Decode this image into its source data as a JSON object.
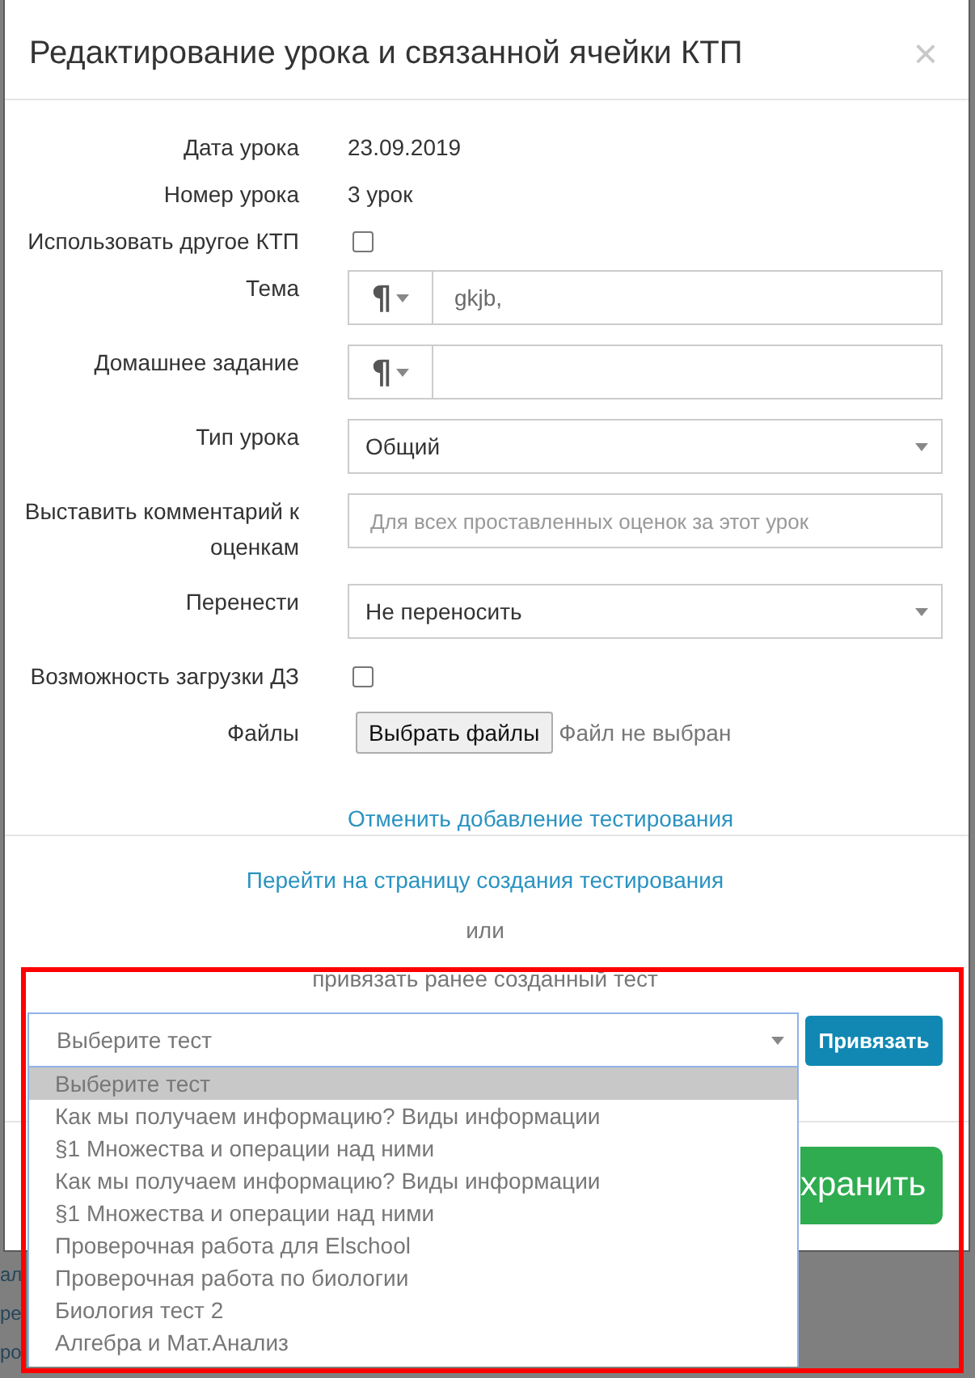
{
  "dialog": {
    "title": "Редактирование урока и связанной ячейки КТП",
    "close": "×"
  },
  "fields": [
    {
      "kind": "text",
      "label": "Дата урока",
      "value": "23.09.2019"
    },
    {
      "kind": "text",
      "label": "Номер урока",
      "value": "3 урок"
    },
    {
      "kind": "checkbox",
      "label": "Использовать другое КТП",
      "checked": false
    },
    {
      "kind": "editor",
      "label": "Тема",
      "addon": "¶",
      "value": "gkjb,"
    },
    {
      "kind": "editor",
      "label": "Домашнее задание",
      "addon": "¶"
    },
    {
      "kind": "select",
      "label": "Тип урока",
      "value": "Общий"
    },
    {
      "kind": "input",
      "label": "Выставить комментарий к оценкам",
      "placeholder": "Для всех проставленных оценок за этот урок"
    },
    {
      "kind": "select",
      "label": "Перенести",
      "value": "Не переносить"
    },
    {
      "kind": "checkbox",
      "label": "Возможность загрузки ДЗ",
      "checked": false
    },
    {
      "kind": "file",
      "label": "Файлы",
      "button": "Выбрать файлы",
      "status": "Файл не выбран"
    }
  ],
  "testing": {
    "cancel_link": "Отменить добавление тестирования",
    "create_link": "Перейти на страницу создания тестирования",
    "or": "или",
    "attach_caption": "привязать ранее созданный тест",
    "select_placeholder": "Выберите тест",
    "attach_button": "Привязать",
    "expanded": true,
    "options": [
      {
        "label": "Выберите тест",
        "selected": true
      },
      {
        "label": "Как мы получаем информацию? Виды информации",
        "selected": false
      },
      {
        "label": "§1 Множества и операции над ними",
        "selected": false
      },
      {
        "label": "Как мы получаем информацию? Виды информации",
        "selected": false
      },
      {
        "label": "§1 Множества и операции над ними",
        "selected": false
      },
      {
        "label": "Проверочная работа для Elschool",
        "selected": false
      },
      {
        "label": "Проверочная работа по биологии",
        "selected": false
      },
      {
        "label": "Биология тест 2",
        "selected": false
      },
      {
        "label": "Алгебра и Мат.Анализ",
        "selected": false
      }
    ]
  },
  "save_button": "хранить",
  "background_fragments": [
    "ал",
    "ре",
    "ро"
  ],
  "highlight_frame": true
}
